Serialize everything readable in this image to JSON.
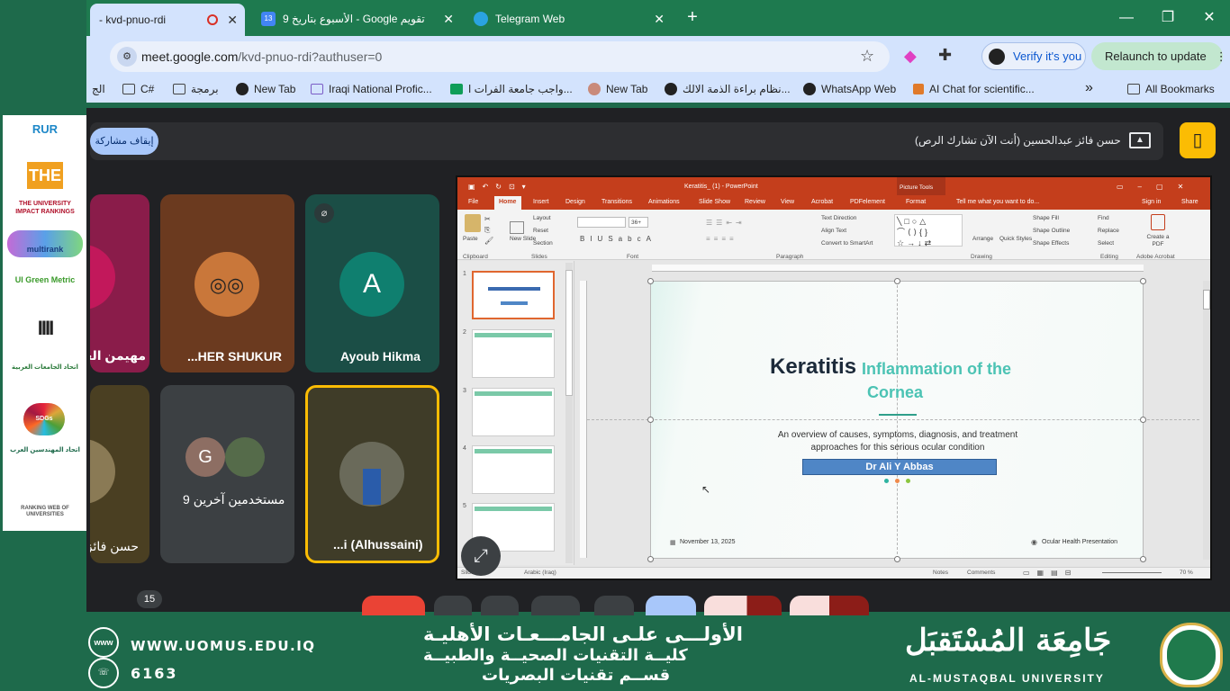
{
  "browser": {
    "tabs": [
      {
        "title": "- kvd-pnuo-rdi",
        "active": true,
        "recording": true
      },
      {
        "title": "تقويم Google - الأسبوع بتاريخ 9",
        "active": false,
        "favicon": "13"
      },
      {
        "title": "Telegram Web",
        "active": false
      }
    ],
    "url_host": "meet.google.com",
    "url_path": "/kvd-pnuo-rdi?authuser=0",
    "verify_label": "Verify it's you",
    "relaunch_label": "Relaunch to update",
    "bookmarks": [
      {
        "label": "الج",
        "icon": "folder-icon"
      },
      {
        "label": "C#",
        "icon": "folder-icon"
      },
      {
        "label": "برمجة",
        "icon": "folder-icon"
      },
      {
        "label": "New Tab",
        "icon": "globe-icon"
      },
      {
        "label": "Iraqi National Profic...",
        "icon": "cube-icon"
      },
      {
        "label": "واجب جامعة الفرات ا...",
        "icon": "sheet-icon"
      },
      {
        "label": "New Tab",
        "icon": "avatar-icon"
      },
      {
        "label": "نظام براءة الذمة الالك...",
        "icon": "globe-icon"
      },
      {
        "label": "WhatsApp Web",
        "icon": "globe-icon"
      },
      {
        "label": "AI Chat for scientific...",
        "icon": "ai-icon"
      }
    ],
    "all_bookmarks": "All Bookmarks",
    "more_bookmarks": "»"
  },
  "meet": {
    "stop_sharing_label": "إيقاف مشاركة",
    "banner_text": "حسن فائز عبدالحسين (أنت الآن تشارك الرص)",
    "participants": [
      {
        "name": "مهيمن العا",
        "tile_color": "#8a1c4a"
      },
      {
        "name": "...HER SHUKUR",
        "tile_color": "#6b3a1f"
      },
      {
        "name": "Ayoub Hikma",
        "initial": "A",
        "tile_color": "#1b4e46",
        "avatar_color": "#0f7f6f",
        "muted": true
      },
      {
        "name": "حسن فائز",
        "tile_color": "#4a3f22"
      },
      {
        "name": "9 مستخدمين آخرين",
        "initial": "G",
        "tile_color": "#3c4043",
        "avatar_color": "#8d6e63"
      },
      {
        "name": "...i (Alhussaini)",
        "tile_color": "#3f3c28",
        "speaking": true
      }
    ],
    "participant_count": "15"
  },
  "ppt": {
    "window_title": "Keratitis_ (1) - PowerPoint",
    "picture_tools": "Picture Tools",
    "tabs": [
      "File",
      "Home",
      "Insert",
      "Design",
      "Transitions",
      "Animations",
      "Slide Show",
      "Review",
      "View",
      "Acrobat",
      "PDFelement",
      "Format"
    ],
    "tell_me": "Tell me what you want to do...",
    "sign_in": "Sign in",
    "share": "Share",
    "ribbon": {
      "paste": "Paste",
      "layout": "Layout",
      "reset": "Reset",
      "new_slide": "New Slide",
      "section": "Section",
      "font_size": "36+",
      "text_direction": "Text Direction",
      "align_text": "Align Text",
      "convert_smartart": "Convert to SmartArt",
      "arrange": "Arrange",
      "quick_styles": "Quick Styles",
      "shape_fill": "Shape Fill",
      "shape_outline": "Shape Outline",
      "shape_effects": "Shape Effects",
      "find": "Find",
      "replace": "Replace",
      "select": "Select",
      "create_pdf": "Create a PDF",
      "groups": [
        "Clipboard",
        "Slides",
        "Font",
        "Paragraph",
        "Drawing",
        "Editing",
        "Adobe Acrobat"
      ]
    },
    "slide_numbers": [
      "1",
      "2",
      "3",
      "4",
      "5"
    ],
    "slide": {
      "title_main": "Keratitis",
      "title_accent_1": "Inflammation of the",
      "title_accent_2": "Cornea",
      "subtitle_1": "An overview of causes, symptoms, diagnosis, and treatment",
      "subtitle_2": "approaches for this serious ocular condition",
      "author": "Dr Ali Y Abbas",
      "date": "November 13, 2025",
      "footer": "Ocular Health Presentation"
    },
    "status": {
      "slide_label": "Slide",
      "language": "Arabic (Iraq)",
      "notes": "Notes",
      "comments": "Comments",
      "zoom": "70 %"
    }
  },
  "rankings": [
    "RUR",
    "THE",
    "THE UNIVERSITY IMPACT RANKINGS",
    "multirank",
    "UI Green Metric",
    "IIII",
    "اتحاد الجامعات العربية",
    "SDGs",
    "اتحاد المهندسين العرب",
    "RANKING WEB OF UNIVERSITIES"
  ],
  "university": {
    "website": "WWW.UOMUS.EDU.IQ",
    "phone": "6163",
    "www_badge": "www",
    "line1": "الأولـــى علـى الجامـــعـات الأهليـة",
    "line2": "كليــة التقنيات الصحيــة والطبيــة",
    "line3": "قســم تقنيات البصريات",
    "name_ar": "جَامِعَة المُسْتَقبَل",
    "name_en": "AL-MUSTAQBAL UNIVERSITY"
  }
}
